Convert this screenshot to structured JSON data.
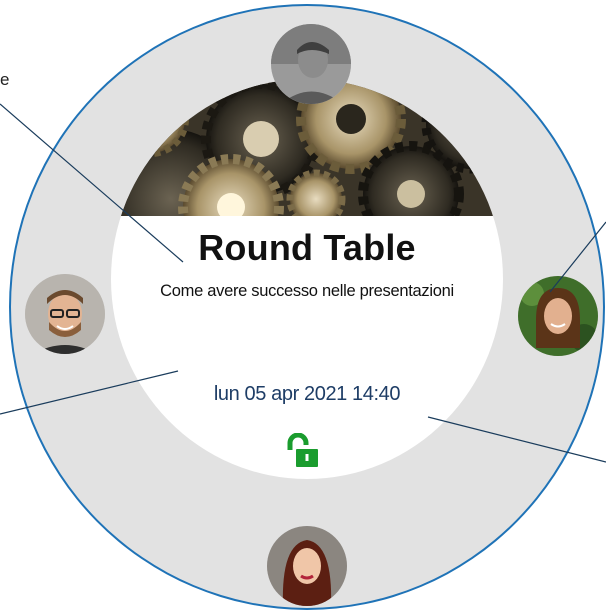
{
  "event": {
    "title": "Round Table",
    "subtitle": "Come avere successo nelle presentazioni",
    "datetime": "lun 05 apr 2021 14:40",
    "lock_state": "unlocked"
  },
  "edge_label": "e",
  "participants": [
    {
      "position": "top",
      "icon": "avatar-photo"
    },
    {
      "position": "left",
      "icon": "avatar-photo"
    },
    {
      "position": "right",
      "icon": "avatar-photo"
    },
    {
      "position": "bottom",
      "icon": "avatar-photo"
    }
  ],
  "colors": {
    "ring_border": "#1f73b7",
    "ring_fill": "#e2e2e2",
    "datetime_text": "#1e3d66",
    "lock_icon": "#1a9c2e",
    "callout_lines": "#1a3c5c"
  }
}
